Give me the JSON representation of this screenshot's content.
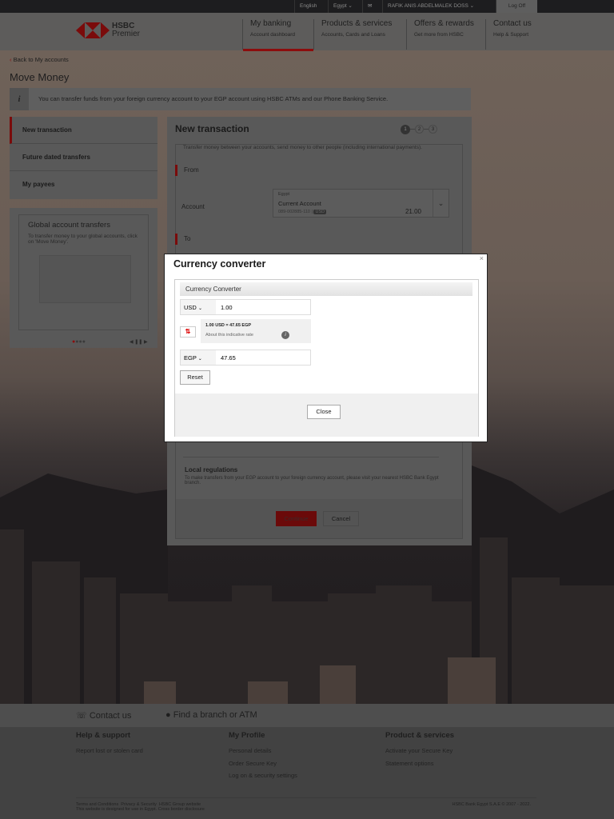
{
  "topbar": {
    "language": "English",
    "country": "Egypt",
    "user": "RAFIK ANIS ABDELMALEK DOSS",
    "logoff": "Log Off"
  },
  "brand": {
    "name": "HSBC",
    "sub": "Premier"
  },
  "nav": [
    {
      "title": "My banking",
      "sub": "Account dashboard"
    },
    {
      "title": "Products & services",
      "sub": "Accounts, Cards and Loans"
    },
    {
      "title": "Offers & rewards",
      "sub": "Get more from HSBC"
    },
    {
      "title": "Contact us",
      "sub": "Help & Support"
    }
  ],
  "back": "Back to My accounts",
  "page_title": "Move Money",
  "info": "You can transfer funds from your foreign currency account to your EGP account using HSBC ATMs and our Phone Banking Service.",
  "sidenav": [
    "New transaction",
    "Future dated transfers",
    "My payees"
  ],
  "promo": {
    "title": "Global account transfers",
    "text": "To transfer money to your global accounts, click on 'Move Money'."
  },
  "main": {
    "title": "New transaction",
    "steps": [
      "1",
      "2",
      "3"
    ],
    "intro": "Transfer money between your accounts, send money to other people (including international payments).",
    "from": "From",
    "account_label": "Account",
    "account": {
      "country": "Egypt",
      "name": "Current Account",
      "number": "089-002885-110",
      "currency": "USD",
      "balance": "21.00"
    },
    "to": "To",
    "local_title": "Local regulations",
    "local_text": "To make transfers from your EGP account to your foreign currency account, please visit your nearest HSBC Bank Egypt branch.",
    "continue": "Continue",
    "cancel": "Cancel"
  },
  "modal": {
    "title": "Currency converter",
    "section": "Currency Converter",
    "from_currency": "USD",
    "from_amount": "1.00",
    "rate": "1.00 USD = 47.65 EGP",
    "rate_info": "About this indicative rate",
    "to_currency": "EGP",
    "to_amount": "47.65",
    "reset": "Reset",
    "close": "Close"
  },
  "footer": {
    "contact": "Contact us",
    "find": "Find a branch or ATM",
    "cols": [
      {
        "title": "Help & support",
        "links": [
          "Report lost or stolen card"
        ]
      },
      {
        "title": "My Profile",
        "links": [
          "Personal details",
          "Order Secure Key",
          "Log on & security settings"
        ]
      },
      {
        "title": "Product & services",
        "links": [
          "Activate your Secure Key",
          "Statement options"
        ]
      }
    ],
    "legal": [
      "Terms and Conditions",
      "Privacy & Security",
      "HSBC Group website"
    ],
    "disclaimer": "This website is designed for use in Egypt. Cross border disclosure",
    "copyright": "HSBC Bank Egypt S.A.E © 2007 - 2022."
  }
}
